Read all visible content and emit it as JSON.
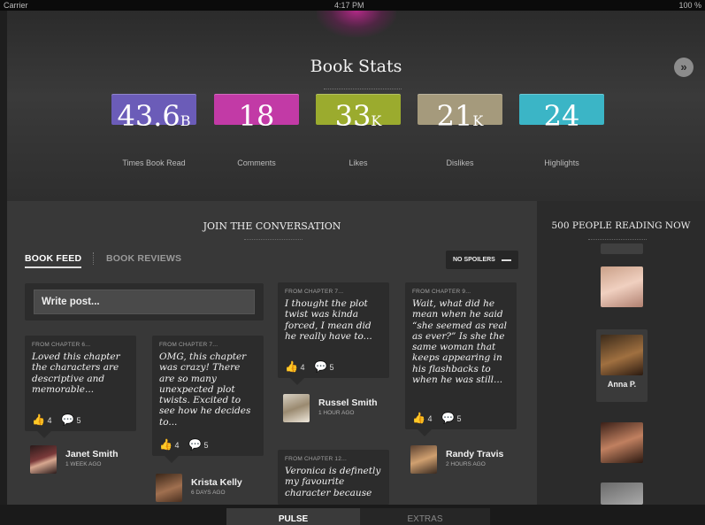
{
  "status_bar": {
    "carrier": "Carrier",
    "time": "4:17 PM",
    "battery": "100 %"
  },
  "hero": {
    "title": "Book Stats",
    "stats": [
      {
        "value": "43.6",
        "unit": "B",
        "label": "Times Book Read",
        "color": "#6b5cb8"
      },
      {
        "value": "18",
        "unit": "",
        "label": "Comments",
        "color": "#c23aa6"
      },
      {
        "value": "33",
        "unit": "K",
        "label": "Likes",
        "color": "#9bab2e"
      },
      {
        "value": "21",
        "unit": "K",
        "label": "Dislikes",
        "color": "#a59a7c"
      },
      {
        "value": "24",
        "unit": "",
        "label": "Highlights",
        "color": "#3bb5c6"
      }
    ]
  },
  "conversation": {
    "title": "JOIN THE CONVERSATION",
    "tabs": [
      "BOOK FEED",
      "BOOK REVIEWS"
    ],
    "spoilers_label": "NO SPOILERS",
    "post_placeholder": "Write post...",
    "posts": [
      {
        "chapter": "FROM CHAPTER 6...",
        "text": "Loved this chapter the characters are descriptive and memorable...",
        "likes": "4",
        "comments": "5",
        "author": "Janet Smith",
        "time": "1 WEEK AGO"
      },
      {
        "chapter": "FROM CHAPTER 7...",
        "text": "OMG, this chapter was crazy! There are so many unexpected plot twists. Excited to see how he decides to...",
        "likes": "4",
        "comments": "5",
        "author": "Krista Kelly",
        "time": "6 DAYS AGO"
      },
      {
        "chapter": "FROM CHAPTER 7...",
        "text": "I thought the plot twist was kinda forced, I mean did he really have to...",
        "likes": "4",
        "comments": "5",
        "author": "Russel Smith",
        "time": "1 HOUR AGO"
      },
      {
        "chapter": "FROM CHAPTER 12...",
        "text": "Veronica is definetly my favourite character because"
      },
      {
        "chapter": "FROM CHAPTER 9...",
        "text": "Wait, what did he mean when he said “she seemed as real as ever?” Is she the same woman that keeps appearing in his flashbacks to when he was still...",
        "likes": "4",
        "comments": "5",
        "author": "Randy Travis",
        "time": "2 HOURS AGO"
      }
    ]
  },
  "sidebar": {
    "title": "500 PEOPLE READING NOW",
    "selected_reader": "Anna P."
  },
  "tab_bar": {
    "pulse": "PULSE",
    "extras": "EXTRAS"
  },
  "icons": {
    "collapse": "double-chevron-down-icon",
    "like": "thumbs-up-icon",
    "comment": "comment-icon"
  }
}
